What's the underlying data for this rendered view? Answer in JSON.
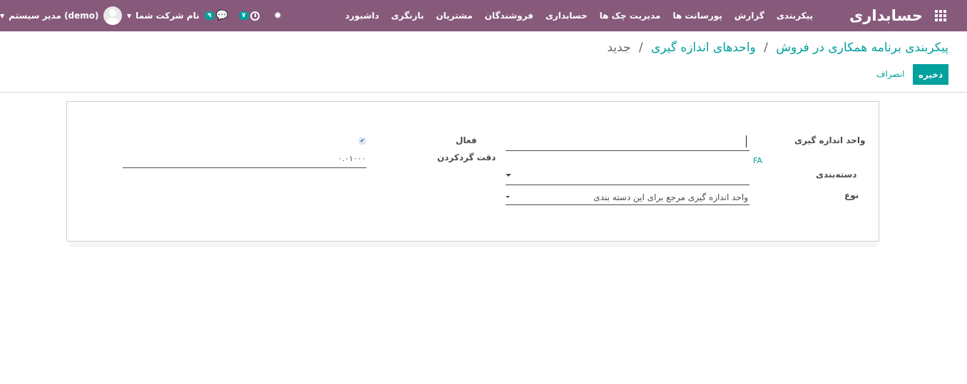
{
  "navbar": {
    "brand": "حسابداری",
    "menu": [
      "داشبورد",
      "بازنگری",
      "مشتریان",
      "فروشندگان",
      "حسابداری",
      "مدیریت چک ها",
      "پورسانت ها",
      "گزارش",
      "پیکربندی"
    ],
    "activity_count": "۷",
    "message_count": "۹",
    "company": "نام شرکت شما",
    "user": "مدیر سیستم (demo)"
  },
  "breadcrumb": {
    "level1": "پیکربندی برنامه همکاری در فروش",
    "level2": "واحدهای اندازه گیری",
    "current": "جدید",
    "separator": "/"
  },
  "buttons": {
    "save": "ذخیره",
    "discard": "انصراف"
  },
  "form": {
    "uom_label": "واحد اندازه گیری",
    "uom_value": "",
    "fa_label": "FA",
    "category_label": "دسته‌بندی",
    "category_value": "",
    "type_label": "نوع",
    "type_value": "واحد اندازه گیری مرجع برای این دسته بندی",
    "active_label": "فعال",
    "active_checked": true,
    "rounding_label": "دقت گردکردن",
    "rounding_value": "۰.۰۱۰۰۰"
  },
  "colors": {
    "navbar": "#875a7b",
    "accent": "#00a09d"
  }
}
